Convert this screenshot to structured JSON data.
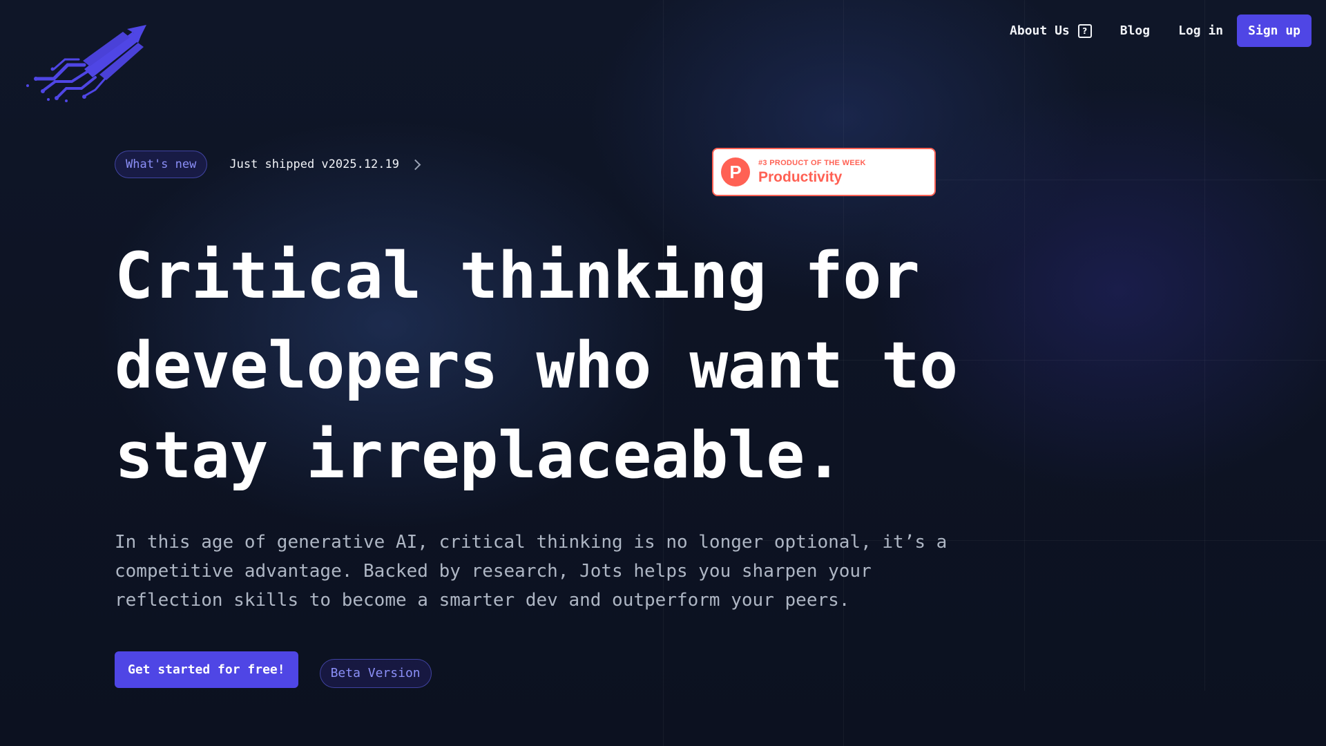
{
  "brand": {
    "logo_icon": "rocket-icon",
    "accent_color": "#4f46e5"
  },
  "nav": {
    "about_label": "About Us",
    "about_icon": "question-mark-icon",
    "help_glyph": "?",
    "blog_label": "Blog",
    "login_label": "Log in",
    "signup_label": "Sign up"
  },
  "announcement": {
    "pill_label": "What's new",
    "text": "Just shipped v2025.12.19",
    "icon": "chevron-right-icon"
  },
  "badge": {
    "logo_letter": "P",
    "top_line": "#3 PRODUCT OF THE WEEK",
    "main_line": "Productivity",
    "color": "#ff6154"
  },
  "hero": {
    "headline_line1": "Critical thinking for",
    "headline_line2": "developers who want to",
    "headline_line3": "stay irreplaceable.",
    "description": "In this age of generative AI, critical thinking is no longer optional, it’s a competitive advantage. Backed by research, Jots helps you sharpen your reflection skills to become a smarter dev and outperform your peers.",
    "cta_label": "Get started for free!",
    "beta_label": "Beta Version"
  }
}
